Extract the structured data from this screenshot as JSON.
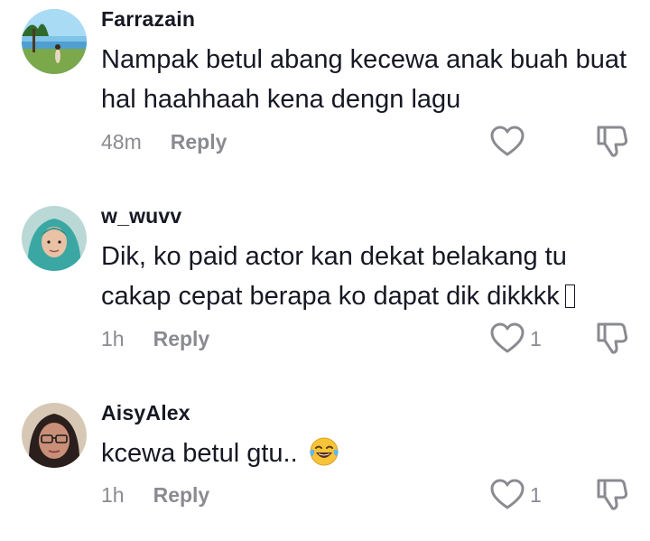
{
  "comments": [
    {
      "username": "Farrazain",
      "text": "Nampak betul abang kecewa anak buah buat hal haahhaah kena dengn lagu",
      "time": "48m",
      "reply_label": "Reply",
      "like_count": "",
      "avatar_icon": "beach-photo-avatar"
    },
    {
      "username": "w_wuvv",
      "text": "Dik, ko paid actor kan dekat belakang tu cakap cepat berapa ko dapat dik dikkkk",
      "time": "1h",
      "reply_label": "Reply",
      "like_count": "1",
      "avatar_icon": "hijab-woman-avatar"
    },
    {
      "username": "AisyAlex",
      "text": "kcewa betul gtu..",
      "time": "1h",
      "reply_label": "Reply",
      "like_count": "1",
      "avatar_icon": "glasses-woman-avatar",
      "emoji": "face-with-tears-of-joy"
    }
  ],
  "colors": {
    "text": "#161823",
    "meta": "#8a8b91",
    "icon": "#8a8b91"
  }
}
